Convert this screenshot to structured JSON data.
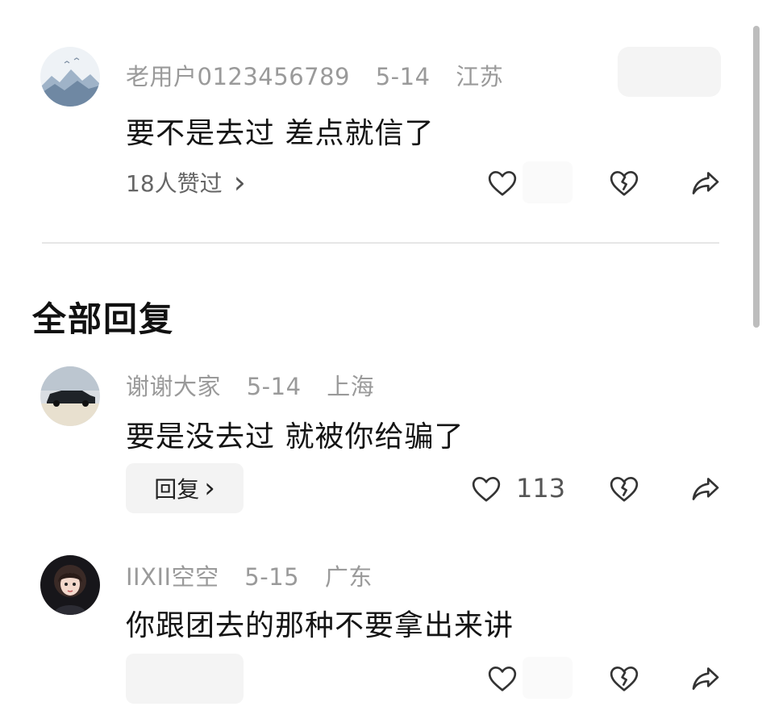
{
  "top_comment": {
    "username": "老用户0123456789",
    "date": "5-14",
    "location": "江苏",
    "text": "要不是去过 差点就信了",
    "likes_text": "18人赞过",
    "likes_chevron": "›"
  },
  "section": {
    "title": "全部回复"
  },
  "replies": [
    {
      "username": "谢谢大家",
      "date": "5-14",
      "location": "上海",
      "text": "要是没去过 就被你给骗了",
      "reply_label": "回复",
      "reply_chevron": "›",
      "like_count": "113"
    },
    {
      "username": "IIXII空空",
      "date": "5-15",
      "location": "广东",
      "text": "你跟团去的那种不要拿出来讲"
    }
  ],
  "icons": {
    "like": "heart-outline-icon",
    "dislike": "broken-heart-icon",
    "share": "share-arrow-icon"
  },
  "colors": {
    "meta_text": "#9a9a9a",
    "body_text": "#141414",
    "icon_stroke": "#333333",
    "pill_bg": "#f3f3f3"
  }
}
